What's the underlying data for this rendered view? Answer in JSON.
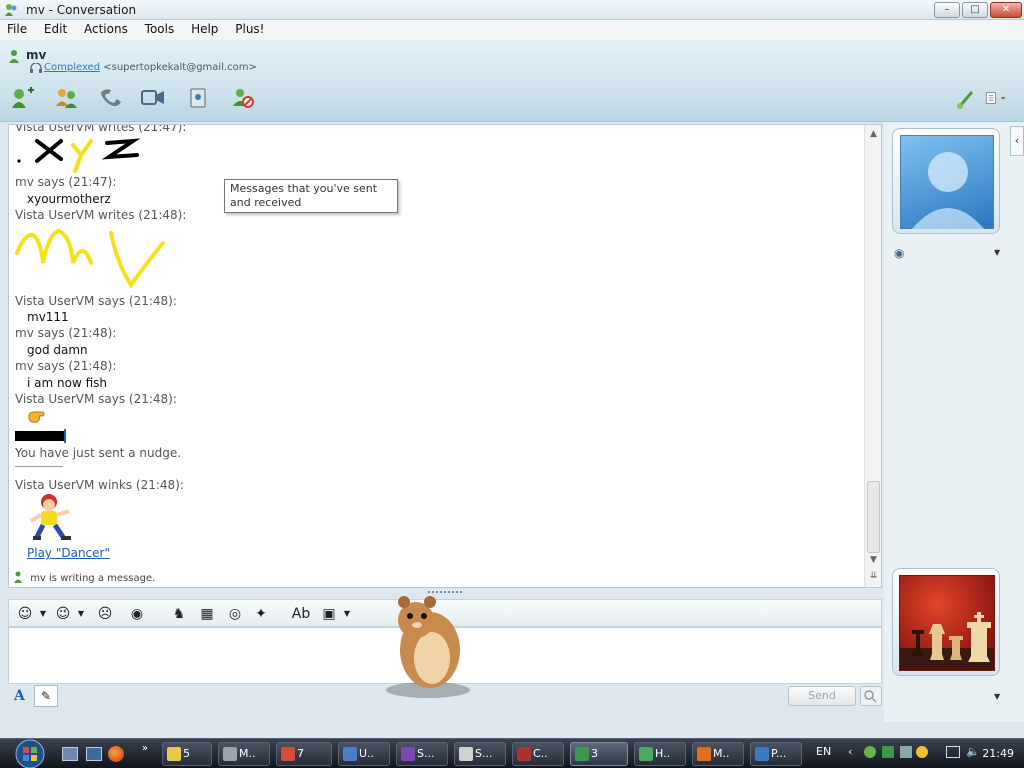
{
  "window": {
    "title": "mv - Conversation",
    "buttons": {
      "minimize": "–",
      "maximize": "□",
      "close": "✕"
    }
  },
  "menu": [
    "File",
    "Edit",
    "Actions",
    "Tools",
    "Help",
    "Plus!"
  ],
  "header": {
    "contact_name": "mv",
    "listening": "Complexed",
    "email": "<supertopkekalt@gmail.com>"
  },
  "toolbar_icons": [
    "invite-contact-icon",
    "share-files-icon",
    "call-icon",
    "video-call-icon",
    "activities-icon",
    "block-contact-icon"
  ],
  "conversation": {
    "lines": [
      {
        "kind": "sender",
        "text": "Vista UserVM writes (21:47):"
      },
      {
        "kind": "sender",
        "text": "mv says (21:47):"
      },
      {
        "kind": "message",
        "text": "xyourmotherz"
      },
      {
        "kind": "sender",
        "text": "Vista UserVM writes (21:48):"
      },
      {
        "kind": "sender",
        "text": "Vista UserVM says (21:48):"
      },
      {
        "kind": "message",
        "text": "mv111"
      },
      {
        "kind": "sender",
        "text": "mv says (21:48):"
      },
      {
        "kind": "message",
        "text": "god damn"
      },
      {
        "kind": "sender",
        "text": "mv says (21:48):"
      },
      {
        "kind": "message",
        "text": "i am now fish"
      },
      {
        "kind": "sender",
        "text": "Vista UserVM says (21:48):"
      },
      {
        "kind": "notice",
        "text": "You have just sent a nudge."
      },
      {
        "kind": "sender",
        "text": "Vista UserVM winks (21:48):"
      }
    ],
    "wink_link": "Play \"Dancer\"",
    "typing_status": "mv is writing a message.",
    "tooltip": "Messages that you've sent and received"
  },
  "compose": {
    "send_label": "Send",
    "text": ""
  },
  "taskbar": {
    "tasks": [
      {
        "label": "5",
        "color": "#e9c84a"
      },
      {
        "label": "M..",
        "color": "#9aa4b0"
      },
      {
        "label": "7",
        "color": "#d84a3a"
      },
      {
        "label": "U..",
        "color": "#4a7fc8"
      },
      {
        "label": "S...",
        "color": "#7a4ab0"
      },
      {
        "label": "S...",
        "color": "#d0d0d0"
      },
      {
        "label": "C..",
        "color": "#b03030"
      },
      {
        "label": "3",
        "color": "#3a9a4a"
      },
      {
        "label": "H..",
        "color": "#4aa860"
      },
      {
        "label": "M..",
        "color": "#e07020"
      },
      {
        "label": "P...",
        "color": "#3a7ac0"
      }
    ],
    "language": "EN",
    "clock": "21:49"
  },
  "colors": {
    "link": "#1a5fb4",
    "header_bg": "#cfe3ed",
    "taskbar_bg": "#1b212b"
  }
}
